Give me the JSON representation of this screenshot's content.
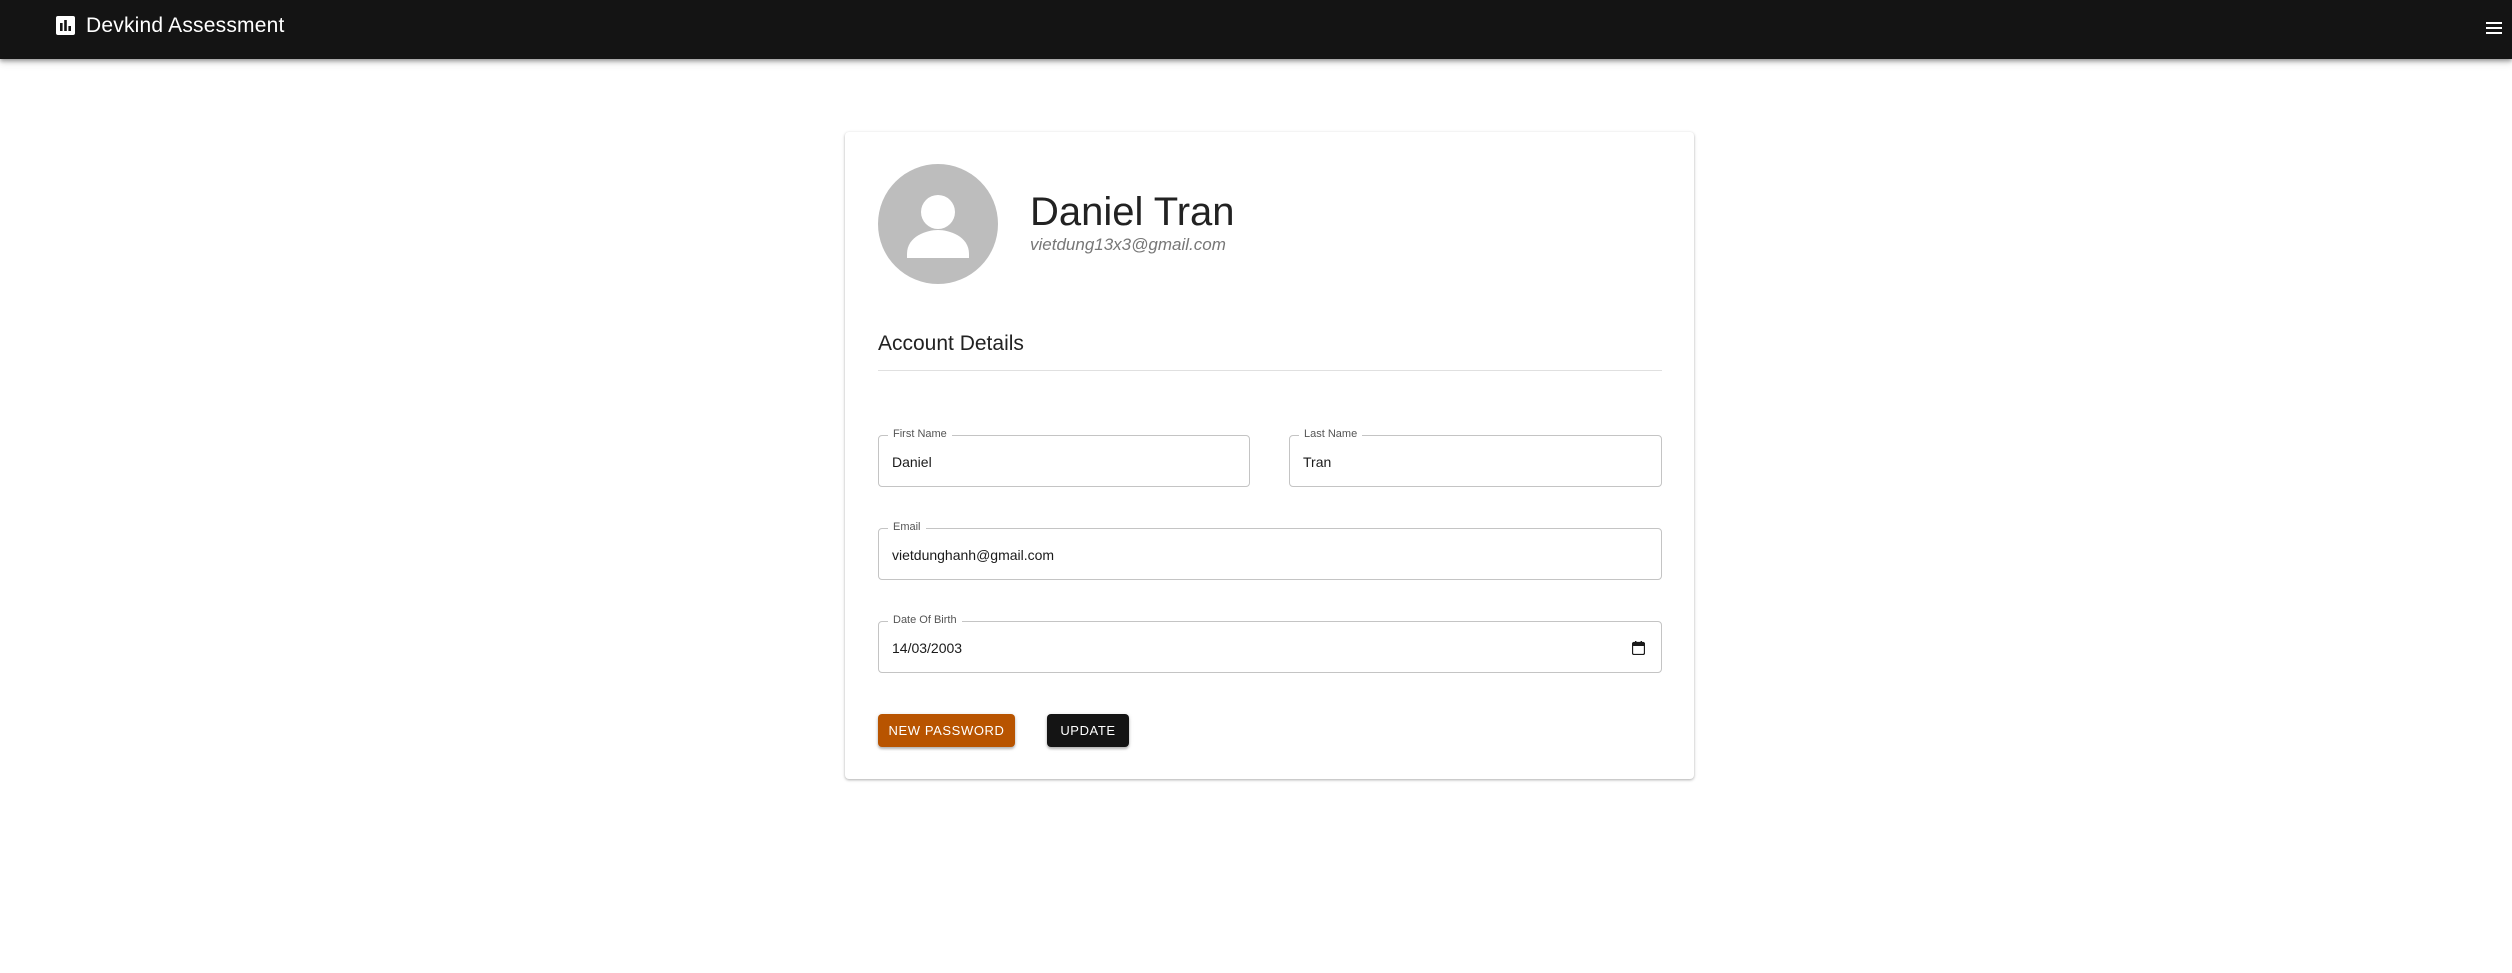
{
  "appbar": {
    "title": "Devkind Assessment",
    "brand_icon": "bar-chart-icon",
    "menu_icon": "hamburger-menu-icon",
    "background": "#141414"
  },
  "profile": {
    "name": "Daniel Tran",
    "email": "vietdung13x3@gmail.com",
    "avatar_icon": "person-icon"
  },
  "account": {
    "section_title": "Account Details",
    "first_name": {
      "label": "First Name",
      "value": "Daniel"
    },
    "last_name": {
      "label": "Last Name",
      "value": "Tran"
    },
    "email": {
      "label": "Email",
      "value": "vietdunghanh@gmail.com"
    },
    "dob": {
      "label": "Date Of Birth",
      "value": "14/03/2003",
      "icon": "calendar-icon"
    }
  },
  "actions": {
    "new_password": "New Password",
    "update": "Update"
  },
  "colors": {
    "new_password_button": "#b85400",
    "update_button": "#141414"
  }
}
